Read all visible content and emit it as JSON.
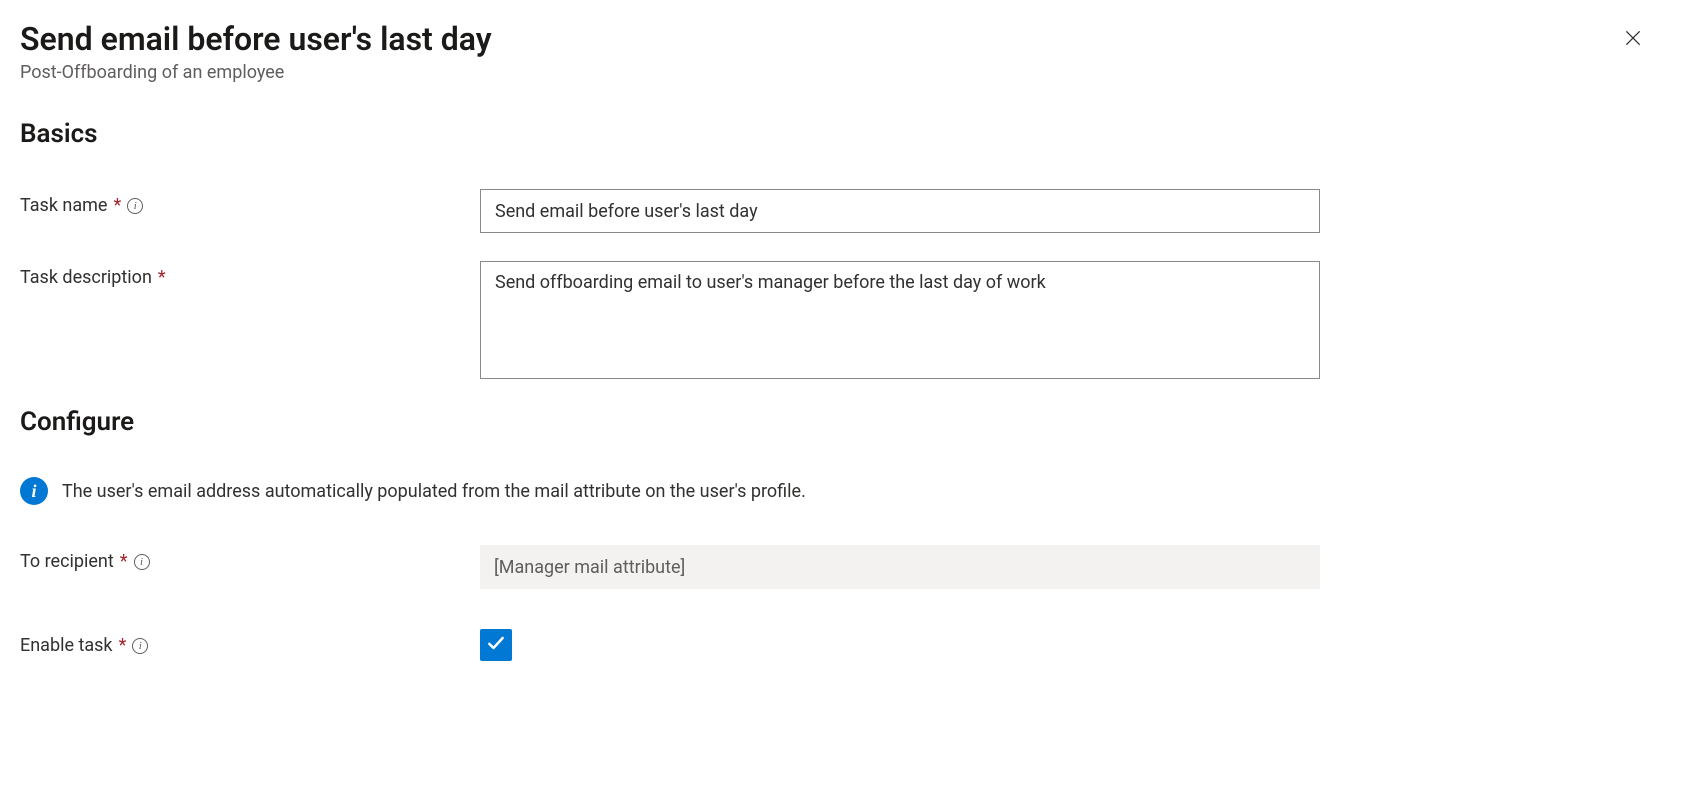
{
  "header": {
    "title": "Send email before user's last day",
    "subtitle": "Post-Offboarding of an employee"
  },
  "basics": {
    "heading": "Basics",
    "task_name_label": "Task name",
    "task_name_value": "Send email before user's last day",
    "task_description_label": "Task description",
    "task_description_value": "Send offboarding email to user's manager before the last day of work"
  },
  "configure": {
    "heading": "Configure",
    "info_text": "The user's email address automatically populated from the mail attribute on the user's profile.",
    "to_recipient_label": "To recipient",
    "to_recipient_value": "[Manager mail attribute]",
    "enable_task_label": "Enable task",
    "enable_task_checked": true
  }
}
